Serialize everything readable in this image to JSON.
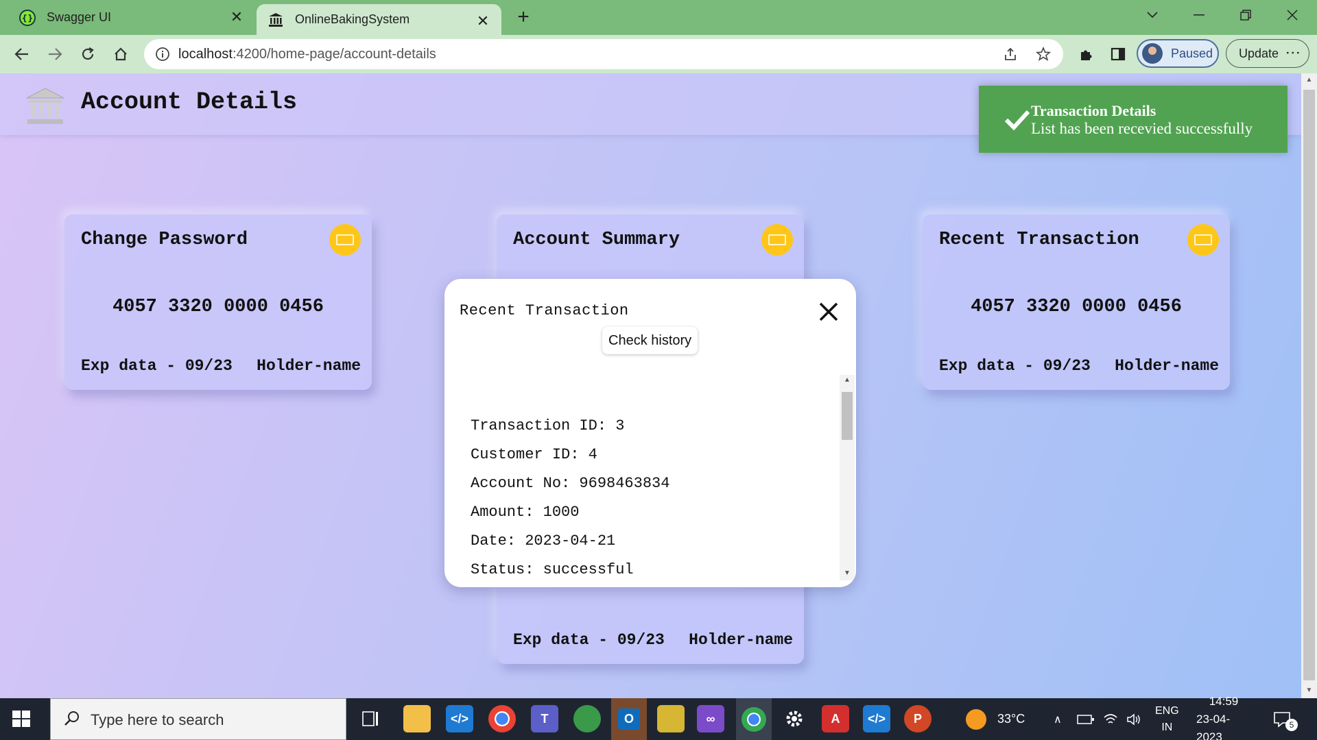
{
  "browser": {
    "tabs": [
      {
        "title": "Swagger UI",
        "active": false,
        "icon": "swagger-icon"
      },
      {
        "title": "OnlineBakingSystem",
        "active": true,
        "icon": "bank-icon"
      }
    ],
    "url_host": "localhost",
    "url_path": ":4200/home-page/account-details",
    "profile_label": "Paused",
    "update_label": "Update"
  },
  "page": {
    "title": "Account Details",
    "cards": [
      {
        "title": "Change Password",
        "number": "4057 3320 0000 0456",
        "exp": "Exp data - 09/23",
        "holder": "Holder-name"
      },
      {
        "title": "Account Summary",
        "number": "4057 3320 0000 0456",
        "exp": "Exp data - 09/23",
        "holder": "Holder-name"
      },
      {
        "title": "Recent Transaction",
        "number": "4057 3320 0000 0456",
        "exp": "Exp data - 09/23",
        "holder": "Holder-name"
      }
    ]
  },
  "toast": {
    "title": "Transaction Details",
    "message": "List has been recevied successfully",
    "color": "#51a351"
  },
  "modal": {
    "title": "Recent Transaction",
    "history_button": "Check history",
    "fields": [
      "Transaction ID: 3",
      "Customer ID: 4",
      "Account No: 9698463834",
      "Amount: 1000",
      "Date: 2023-04-21",
      "Status: successful"
    ]
  },
  "taskbar": {
    "search_placeholder": "Type here to search",
    "weather": "33°C",
    "lang_top": "ENG",
    "lang_bottom": "IN",
    "time": "14:59",
    "date": "23-04-2023",
    "notification_count": "5"
  }
}
